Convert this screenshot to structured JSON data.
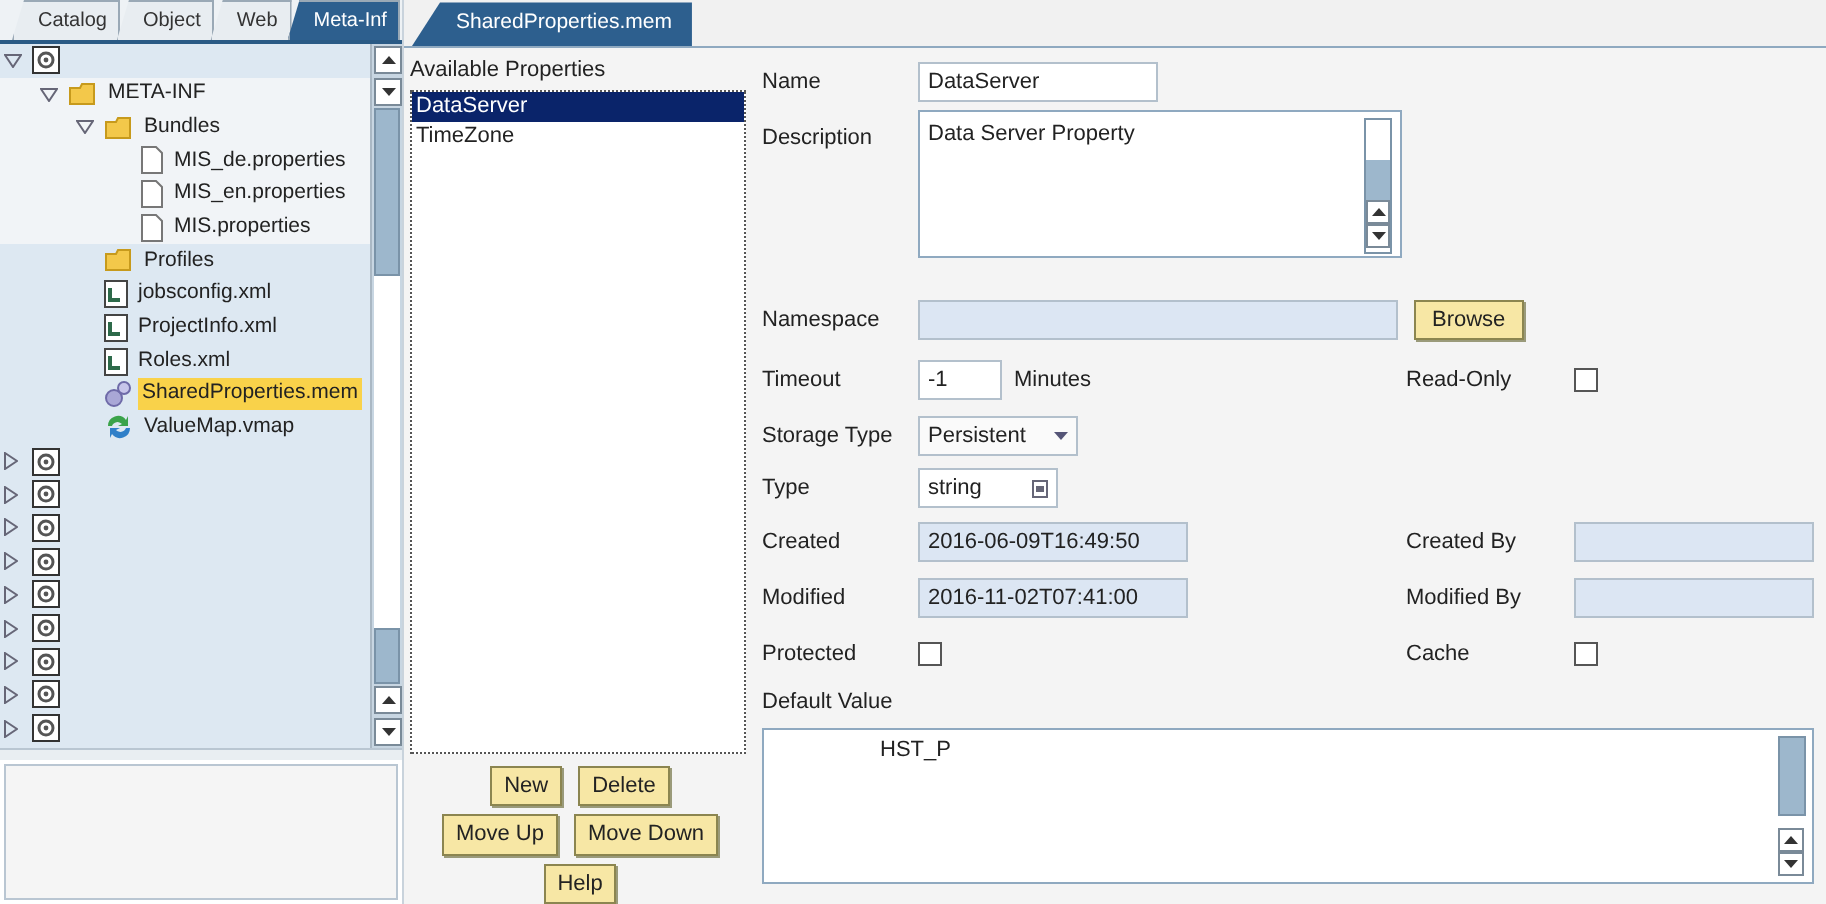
{
  "left_tabs": [
    {
      "label": "Catalog",
      "selected": false
    },
    {
      "label": "Object",
      "selected": false
    },
    {
      "label": "Web",
      "selected": false
    },
    {
      "label": "Meta-Inf",
      "selected": true
    }
  ],
  "tree": [
    {
      "kind": "project",
      "expanded": true,
      "children": [
        {
          "label": "META-INF",
          "kind": "folder",
          "expanded": true,
          "children": [
            {
              "label": "Bundles",
              "kind": "folder",
              "expanded": true,
              "children": [
                {
                  "label": "MIS_de.properties",
                  "kind": "file",
                  "selected": false
                },
                {
                  "label": "MIS_en.properties",
                  "kind": "file",
                  "selected": false
                },
                {
                  "label": "MIS.properties",
                  "kind": "file",
                  "selected": false
                }
              ]
            },
            {
              "label": "Profiles",
              "kind": "folder",
              "selected": false
            },
            {
              "label": "jobsconfig.xml",
              "kind": "xml",
              "selected": false
            },
            {
              "label": "ProjectInfo.xml",
              "kind": "xml",
              "selected": false
            },
            {
              "label": "Roles.xml",
              "kind": "xml",
              "selected": false
            },
            {
              "label": "SharedProperties.mem",
              "kind": "mem",
              "selected": true
            },
            {
              "label": "ValueMap.vmap",
              "kind": "vmap",
              "selected": false
            }
          ]
        }
      ]
    },
    {
      "kind": "project",
      "expanded": false
    },
    {
      "kind": "project",
      "expanded": false
    },
    {
      "kind": "project",
      "expanded": false
    },
    {
      "kind": "project",
      "expanded": false
    },
    {
      "kind": "project",
      "expanded": false
    },
    {
      "kind": "project",
      "expanded": false
    },
    {
      "kind": "project",
      "expanded": false
    },
    {
      "kind": "project",
      "expanded": false
    },
    {
      "kind": "project",
      "expanded": false
    }
  ],
  "editor_tab": {
    "label": "SharedProperties.mem",
    "selected": true
  },
  "properties_list": {
    "label": "Available Properties",
    "items": [
      {
        "label": "DataServer",
        "selected": true
      },
      {
        "label": "TimeZone",
        "selected": false
      }
    ]
  },
  "list_buttons": [
    [
      "New",
      "Delete"
    ],
    [
      "Move Up",
      "Move Down"
    ],
    [
      "Help"
    ]
  ],
  "form": [
    {
      "label": "Name",
      "kind": "text",
      "value": "DataServer"
    },
    {
      "label": "Description",
      "kind": "textarea",
      "value": "Data Server Property"
    },
    {
      "label": "Namespace",
      "kind": "browse",
      "button": "Browse"
    },
    {
      "label": "Timeout",
      "kind": "number",
      "value": "-1",
      "unit": "Minutes",
      "right": {
        "label": "Read-Only",
        "kind": "checkbox",
        "checked": false
      }
    },
    {
      "label": "Storage Type",
      "kind": "combo",
      "value": "Persistent"
    },
    {
      "label": "Type",
      "kind": "combo2",
      "value": "string"
    },
    {
      "label": "Created",
      "kind": "readonly",
      "value": "2016-06-09T16:49:50",
      "right": {
        "label": "Created By",
        "kind": "readonly"
      }
    },
    {
      "label": "Modified",
      "kind": "readonly",
      "value": "2016-11-02T07:41:00",
      "right": {
        "label": "Modified By",
        "kind": "readonly"
      }
    },
    {
      "label": "Protected",
      "kind": "checkbox",
      "checked": false,
      "right": {
        "label": "Cache",
        "kind": "checkbox",
        "checked": false
      }
    }
  ],
  "default_value": {
    "label": "Default Value",
    "value": "HST_P"
  }
}
